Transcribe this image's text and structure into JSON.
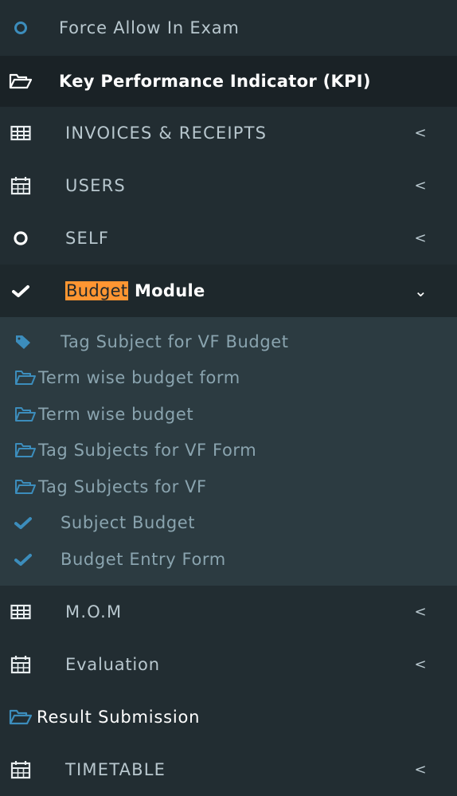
{
  "colors": {
    "sidebar_bg": "#222d32",
    "active_bg": "#1e282c",
    "submenu_bg": "#2c3b41",
    "text": "#b8c7ce",
    "subtext": "#8aa4af",
    "accent_blue": "#3c8dbc",
    "highlight": "#ff9632"
  },
  "menu": {
    "force_allow": {
      "label": "Force Allow In Exam",
      "icon": "circle-o-icon"
    },
    "kpi": {
      "label": "Key Performance Indicator (KPI)",
      "icon": "folder-open-icon"
    },
    "invoices": {
      "label": "INVOICES & RECEIPTS",
      "icon": "table-icon",
      "chevron": "<"
    },
    "users": {
      "label": "USERS",
      "icon": "calendar-icon",
      "chevron": "<"
    },
    "self": {
      "label": "SELF",
      "icon": "circle-o-icon",
      "chevron": "<"
    },
    "budget": {
      "highlight": "Budget",
      "label": "Module",
      "icon": "check-icon",
      "chevron": "⌄",
      "sub_items": [
        {
          "label": "Tag Subject for VF Budget",
          "icon": "tag-icon"
        },
        {
          "label": "Term wise budget form",
          "icon": "folder-open-icon"
        },
        {
          "label": "Term wise budget",
          "icon": "folder-open-icon"
        },
        {
          "label": "Tag Subjects for VF Form",
          "icon": "folder-open-icon"
        },
        {
          "label": "Tag Subjects for VF",
          "icon": "folder-open-icon"
        },
        {
          "label": "Subject Budget",
          "icon": "check-icon"
        },
        {
          "label": "Budget Entry Form",
          "icon": "check-icon"
        }
      ]
    },
    "mom": {
      "label": "M.O.M",
      "icon": "table-icon",
      "chevron": "<"
    },
    "evaluation": {
      "label": "Evaluation",
      "icon": "calendar-icon",
      "chevron": "<"
    },
    "result": {
      "label": "Result Submission",
      "icon": "folder-open-icon"
    },
    "timetable": {
      "label": "TIMETABLE",
      "icon": "calendar-icon",
      "chevron": "<"
    }
  }
}
